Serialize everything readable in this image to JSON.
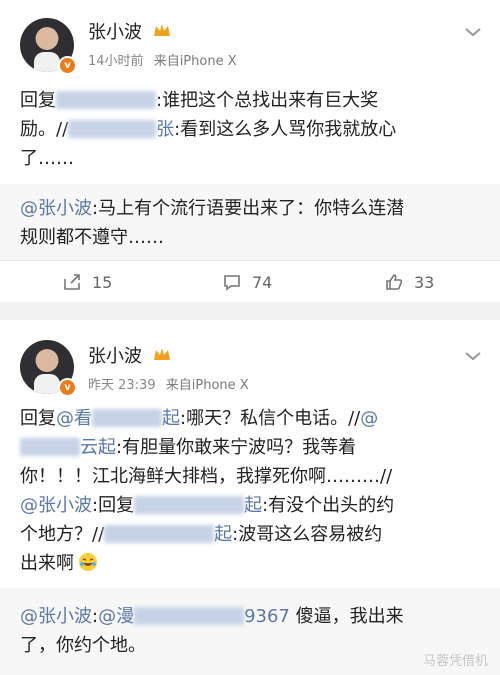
{
  "post1": {
    "author": "张小波",
    "badge": "v",
    "time": "14小时前",
    "source": "来自iPhone X",
    "text_a_prefix": "回复",
    "text_a_suffix": ":谁把这个总找出来有巨大奖",
    "line2_a": "励。//",
    "line2_b": "张",
    "line2_c": ":看到这么多人骂你我就放心",
    "line3": "了……"
  },
  "repost1": {
    "mention": "@张小波",
    "text": ":马上有个流行语要出来了：你特么连潜",
    "line2": "规则都不遵守……"
  },
  "actions": {
    "repost_count": "15",
    "comment_count": "74",
    "like_count": "33",
    "repost_icon": "share-icon",
    "comment_icon": "comment-icon",
    "like_icon": "thumbs-up-icon"
  },
  "post2": {
    "author": "张小波",
    "badge": "v",
    "time": "昨天 23:39",
    "source": "来自iPhone X",
    "l1_prefix": "回复",
    "l1_link": "@看",
    "l1_link2": "起",
    "l1_suffix": ":哪天？私信个电话。//",
    "l1_at": "@",
    "l2_link": "云起",
    "l2_text": ":有胆量你敢来宁波吗？我等着",
    "l3_text": "你！！！江北海鲜大排档，我撑死你啊………",
    "l3_tail": "//",
    "l4_mention": "@张小波",
    "l4_text": ":回复",
    "l4_link": "起",
    "l4_text2": ":有没个出头的约",
    "l5_text": "个地方？//",
    "l5_link": "起",
    "l5_text2": ":波哥这么容易被约",
    "l6_text": "出来啊"
  },
  "repost2": {
    "mention": "@张小波",
    "text1": ":",
    "link": "@漫",
    "link_tail": "9367",
    "text2": " 傻逼，我出来",
    "line2": "了，你约个地。"
  },
  "watermark": "马蓉凭借机"
}
